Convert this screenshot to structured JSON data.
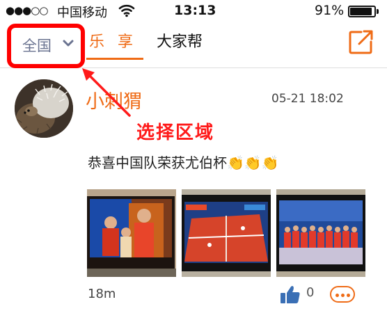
{
  "status_bar": {
    "signal": "●●●○○",
    "carrier": "中国移动",
    "time": "13:13",
    "battery_percent": "91%",
    "battery_level": 0.91,
    "icons": [
      "wifi-icon",
      "battery-icon"
    ]
  },
  "nav": {
    "region_label": "全国",
    "tabs": [
      {
        "label": "乐 享",
        "active": true
      },
      {
        "label": "大家帮",
        "active": false
      }
    ],
    "icons": [
      "chevron-down-icon",
      "share-external-icon"
    ],
    "accent_color": "#ef6b16"
  },
  "post": {
    "username": "小刺猬",
    "timestamp": "05-21 18:02",
    "text": "恭喜中国队荣获尤伯杯",
    "emoji": [
      "👏",
      "👏",
      "👏"
    ],
    "distance": "18m",
    "like_count": "0",
    "icons": [
      "like-thumb-icon",
      "more-icon",
      "hedgehog-avatar"
    ]
  },
  "annotation": {
    "label": "选择区域",
    "color": "#ff1a1a"
  }
}
